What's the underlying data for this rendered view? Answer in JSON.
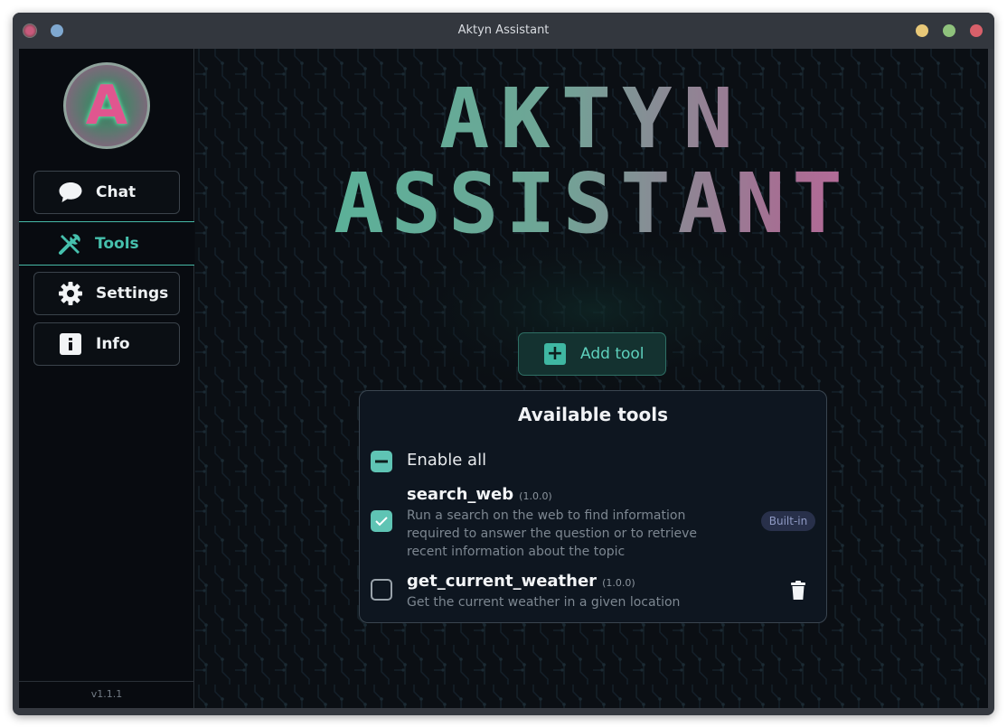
{
  "window": {
    "title": "Aktyn Assistant"
  },
  "sidebar": {
    "avatar_letter": "A",
    "items": [
      {
        "label": "Chat",
        "icon": "chat-bubble-icon",
        "active": false
      },
      {
        "label": "Tools",
        "icon": "tools-icon",
        "active": true
      },
      {
        "label": "Settings",
        "icon": "gear-icon",
        "active": false
      },
      {
        "label": "Info",
        "icon": "info-icon",
        "active": false
      }
    ],
    "version": "v1.1.1"
  },
  "banner": {
    "line1": "AKTYN",
    "line2": "ASSISTANT"
  },
  "main": {
    "add_tool_label": "Add tool",
    "panel": {
      "title": "Available tools",
      "enable_all_label": "Enable all",
      "enable_all_state": "indeterminate",
      "tools": [
        {
          "name": "search_web",
          "version": "(1.0.0)",
          "description": "Run a search on the web to find information required to answer the question or to retrieve recent information about the topic",
          "enabled": true,
          "badge": "Built-in"
        },
        {
          "name": "get_current_weather",
          "version": "(1.0.0)",
          "description": "Get the current weather in a given location",
          "enabled": false,
          "action_icon": "trash-icon"
        }
      ]
    }
  },
  "colors": {
    "accent": "#46c0ad",
    "background": "#0b0f14",
    "panel": "#0e1620",
    "badge": "#28304a"
  }
}
